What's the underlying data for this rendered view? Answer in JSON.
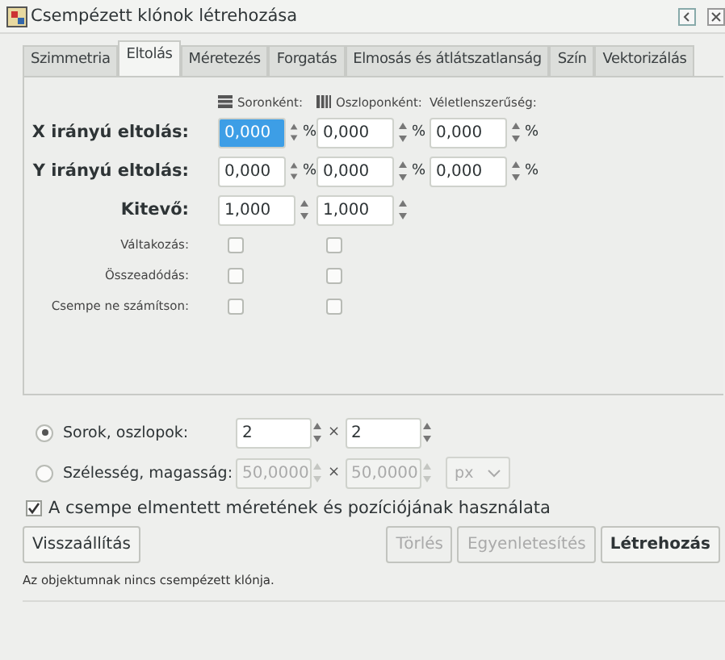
{
  "window": {
    "title": "Csempézett klónok létrehozása"
  },
  "tabs": [
    {
      "label": "Szimmetria",
      "selected": false
    },
    {
      "label": "Eltolás",
      "selected": true
    },
    {
      "label": "Méretezés",
      "selected": false
    },
    {
      "label": "Forgatás",
      "selected": false
    },
    {
      "label": "Elmosás és átlátszatlanság",
      "selected": false
    },
    {
      "label": "Szín",
      "selected": false
    },
    {
      "label": "Vektorizálás",
      "selected": false
    }
  ],
  "column_headers": [
    {
      "label": "Soronként:",
      "kind": "rows"
    },
    {
      "label": "Oszloponként:",
      "kind": "columns"
    },
    {
      "label": "Véletlenszerűség:",
      "kind": "plain"
    }
  ],
  "rows": [
    {
      "label": "X irányú eltolás:",
      "kind": "spin",
      "fields": [
        {
          "value": "0,000",
          "unit": "%",
          "selected": true
        },
        {
          "value": "0,000",
          "unit": "%",
          "selected": false
        },
        {
          "value": "0,000",
          "unit": "%",
          "selected": false
        }
      ]
    },
    {
      "label": "Y irányú eltolás:",
      "kind": "spin",
      "fields": [
        {
          "value": "0,000",
          "unit": "%",
          "selected": false
        },
        {
          "value": "0,000",
          "unit": "%",
          "selected": false
        },
        {
          "value": "0,000",
          "unit": "%",
          "selected": false
        }
      ]
    },
    {
      "label": "Kitevő:",
      "kind": "spin",
      "fields": [
        {
          "value": "1,000",
          "selected": false
        },
        {
          "value": "1,000",
          "selected": false
        }
      ]
    },
    {
      "label": "Váltakozás:",
      "kind": "check",
      "checks": [
        {
          "checked": false
        },
        {
          "checked": false
        }
      ]
    },
    {
      "label": "Összeadódás:",
      "kind": "check",
      "checks": [
        {
          "checked": false
        },
        {
          "checked": false
        }
      ]
    },
    {
      "label": "Csempe ne számítson:",
      "kind": "check",
      "checks": [
        {
          "checked": false
        },
        {
          "checked": false
        }
      ]
    }
  ],
  "size_options": [
    {
      "label": "Sorok, oszlopok:",
      "selected": true,
      "disabled": false,
      "fields": [
        "2",
        "2"
      ],
      "separator": "×"
    },
    {
      "label": "Szélesség, magasság:",
      "selected": false,
      "disabled": true,
      "fields": [
        "50,0000",
        "50,0000"
      ],
      "separator": "×",
      "unit": "px"
    }
  ],
  "use_saved": {
    "label": "A csempe elmentett méretének és pozíciójának használata",
    "checked": true
  },
  "buttons": [
    {
      "label": "Visszaállítás",
      "disabled": false,
      "default": false
    },
    {
      "label": "Törlés",
      "disabled": true,
      "default": false
    },
    {
      "label": "Egyenletesítés",
      "disabled": true,
      "default": false
    },
    {
      "label": "Létrehozás",
      "disabled": false,
      "default": true
    }
  ],
  "status": "Az objektumnak nincs csempézett klónja."
}
